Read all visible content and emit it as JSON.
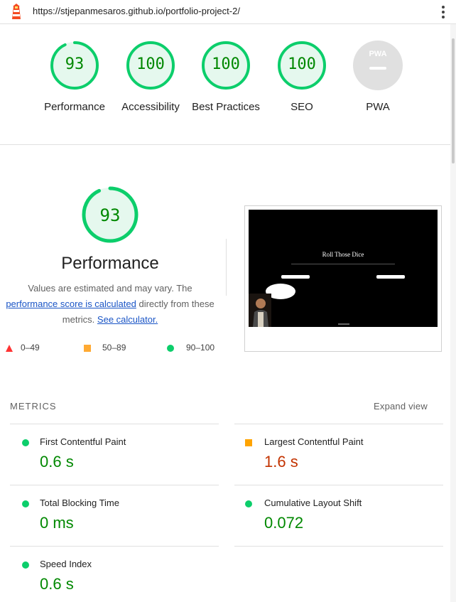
{
  "topbar": {
    "url": "https://stjepanmesaros.github.io/portfolio-project-2/",
    "logo_icon": "lighthouse-icon",
    "menu_icon": "kebab-menu-icon"
  },
  "gauges": [
    {
      "label": "Performance",
      "score": "93",
      "value": 93
    },
    {
      "label": "Accessibility",
      "score": "100",
      "value": 100
    },
    {
      "label": "Best Practices",
      "score": "100",
      "value": 100
    },
    {
      "label": "SEO",
      "score": "100",
      "value": 100
    },
    {
      "label": "PWA",
      "score": "PWA",
      "value": null
    }
  ],
  "performance": {
    "score": "93",
    "value": 93,
    "title": "Performance",
    "desc_1": "Values are estimated and may vary. The",
    "link_score": "performance score is calculated",
    "desc_2": "directly from these metrics.",
    "link_calculator": "See calculator.",
    "legend": [
      {
        "range": "0–49",
        "shape": "triangle",
        "color": "#ff3333"
      },
      {
        "range": "50–89",
        "shape": "square",
        "color": "#ffaa33"
      },
      {
        "range": "90–100",
        "shape": "circle",
        "color": "#0cce6b"
      }
    ],
    "screenshot": {
      "title": "Roll Those Dice"
    }
  },
  "metrics": {
    "heading": "METRICS",
    "expand": "Expand view",
    "items": [
      {
        "label": "First Contentful Paint",
        "value": "0.6 s",
        "status": "pass"
      },
      {
        "label": "Largest Contentful Paint",
        "value": "1.6 s",
        "status": "average"
      },
      {
        "label": "Total Blocking Time",
        "value": "0 ms",
        "status": "pass"
      },
      {
        "label": "Cumulative Layout Shift",
        "value": "0.072",
        "status": "pass"
      },
      {
        "label": "Speed Index",
        "value": "0.6 s",
        "status": "pass"
      }
    ]
  },
  "colors": {
    "pass": "#0cce6b",
    "pass_text": "#008800",
    "average": "#ffa400",
    "average_text": "#c33300",
    "link": "#1a55c6",
    "pwa_gray": "#e0e0e0"
  }
}
